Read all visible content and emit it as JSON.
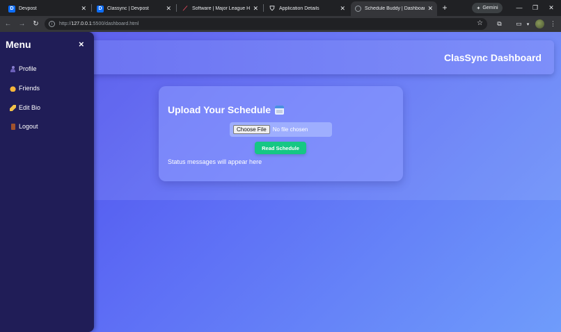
{
  "browser": {
    "tabs": [
      {
        "title": "Devpost",
        "favicon": "devpost-icon",
        "active": false
      },
      {
        "title": "Classync | Devpost",
        "favicon": "devpost-icon",
        "active": false
      },
      {
        "title": "Software | Major League Hack",
        "favicon": "mlh-icon",
        "active": false
      },
      {
        "title": "Application Details",
        "favicon": "shield-icon",
        "active": false
      },
      {
        "title": "Schedule Buddy | Dashboard",
        "favicon": "globe-icon",
        "active": true
      }
    ],
    "gemini_label": "Gemini",
    "url_prefix": "http://",
    "url_host": "127.0.0.1",
    "url_rest": ":5500/dashboard.html"
  },
  "sidebar": {
    "title": "Menu",
    "close": "×",
    "items": [
      {
        "label": "Profile",
        "icon": "profile-icon"
      },
      {
        "label": "Friends",
        "icon": "friends-icon"
      },
      {
        "label": "Edit Bio",
        "icon": "edit-bio-icon"
      },
      {
        "label": "Logout",
        "icon": "logout-icon"
      }
    ]
  },
  "header": {
    "title": "ClasSync Dashboard"
  },
  "upload": {
    "title": "Upload Your Schedule",
    "choose_file": "Choose File",
    "no_file": "No file chosen",
    "read_button": "Read Schedule",
    "status": "Status messages will appear here"
  },
  "colors": {
    "sidebar_bg": "#201d57",
    "accent_button": "#16c784",
    "page_gradient_start": "#4a48e8",
    "page_gradient_end": "#6f9cfb"
  }
}
